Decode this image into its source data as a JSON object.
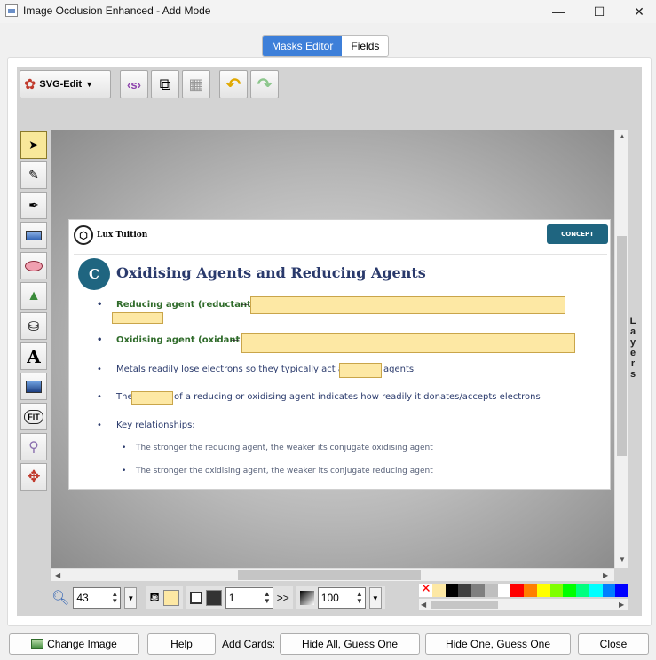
{
  "window": {
    "title": "Image Occlusion Enhanced - Add Mode",
    "minimize": "—",
    "maximize": "☐",
    "close": "✕"
  },
  "tabs": [
    {
      "label": "Masks Editor"
    },
    {
      "label": "Fields"
    }
  ],
  "toolbar": {
    "svgedit_label": "SVG-Edit"
  },
  "slide": {
    "logo_text": "Lux Tuition",
    "concept_label": "CONCEPT",
    "badge": "C",
    "title": "Oxidising Agents and Reducing Agents",
    "bullets": {
      "reducing": "Reducing agent (reductant)",
      "oxidising": "Oxidising agent (oxidant)",
      "metals_pre": "Metals readily lose electrons so they typically act as",
      "metals_post": "agents",
      "the": "The",
      "strength_post": "of a reducing or oxidising agent indicates how readily it donates/accepts electrons",
      "key": "Key relationships:",
      "sub1": "The stronger the reducing agent, the weaker its conjugate oxidising agent",
      "sub2": "The stronger the oxidising agent, the weaker its conjugate reducing agent"
    },
    "dash": "—"
  },
  "layers_label": [
    "L",
    "a",
    "y",
    "e",
    "r",
    "s"
  ],
  "bottom_strip": {
    "zoom": "43",
    "stroke_width": "1",
    "opacity": "100",
    "more": ">>"
  },
  "colors": {
    "mask_fill": "#fde8a4",
    "fill_swatch": "#fde8a4",
    "stroke_swatch": "#333333",
    "palette": [
      "#ffffff",
      "#000000",
      "#3f3f3f",
      "#7f7f7f",
      "#bfbfbf",
      "#ffffff",
      "#ff0000",
      "#ff7f00",
      "#ffff00",
      "#7fff00",
      "#00ff00",
      "#00ff7f",
      "#00ffff",
      "#007fff",
      "#0000ff"
    ]
  },
  "buttons": {
    "change_image": "Change Image",
    "help": "Help",
    "add_cards": "Add Cards:",
    "hide_all": "Hide All, Guess One",
    "hide_one": "Hide One, Guess One",
    "close": "Close"
  }
}
